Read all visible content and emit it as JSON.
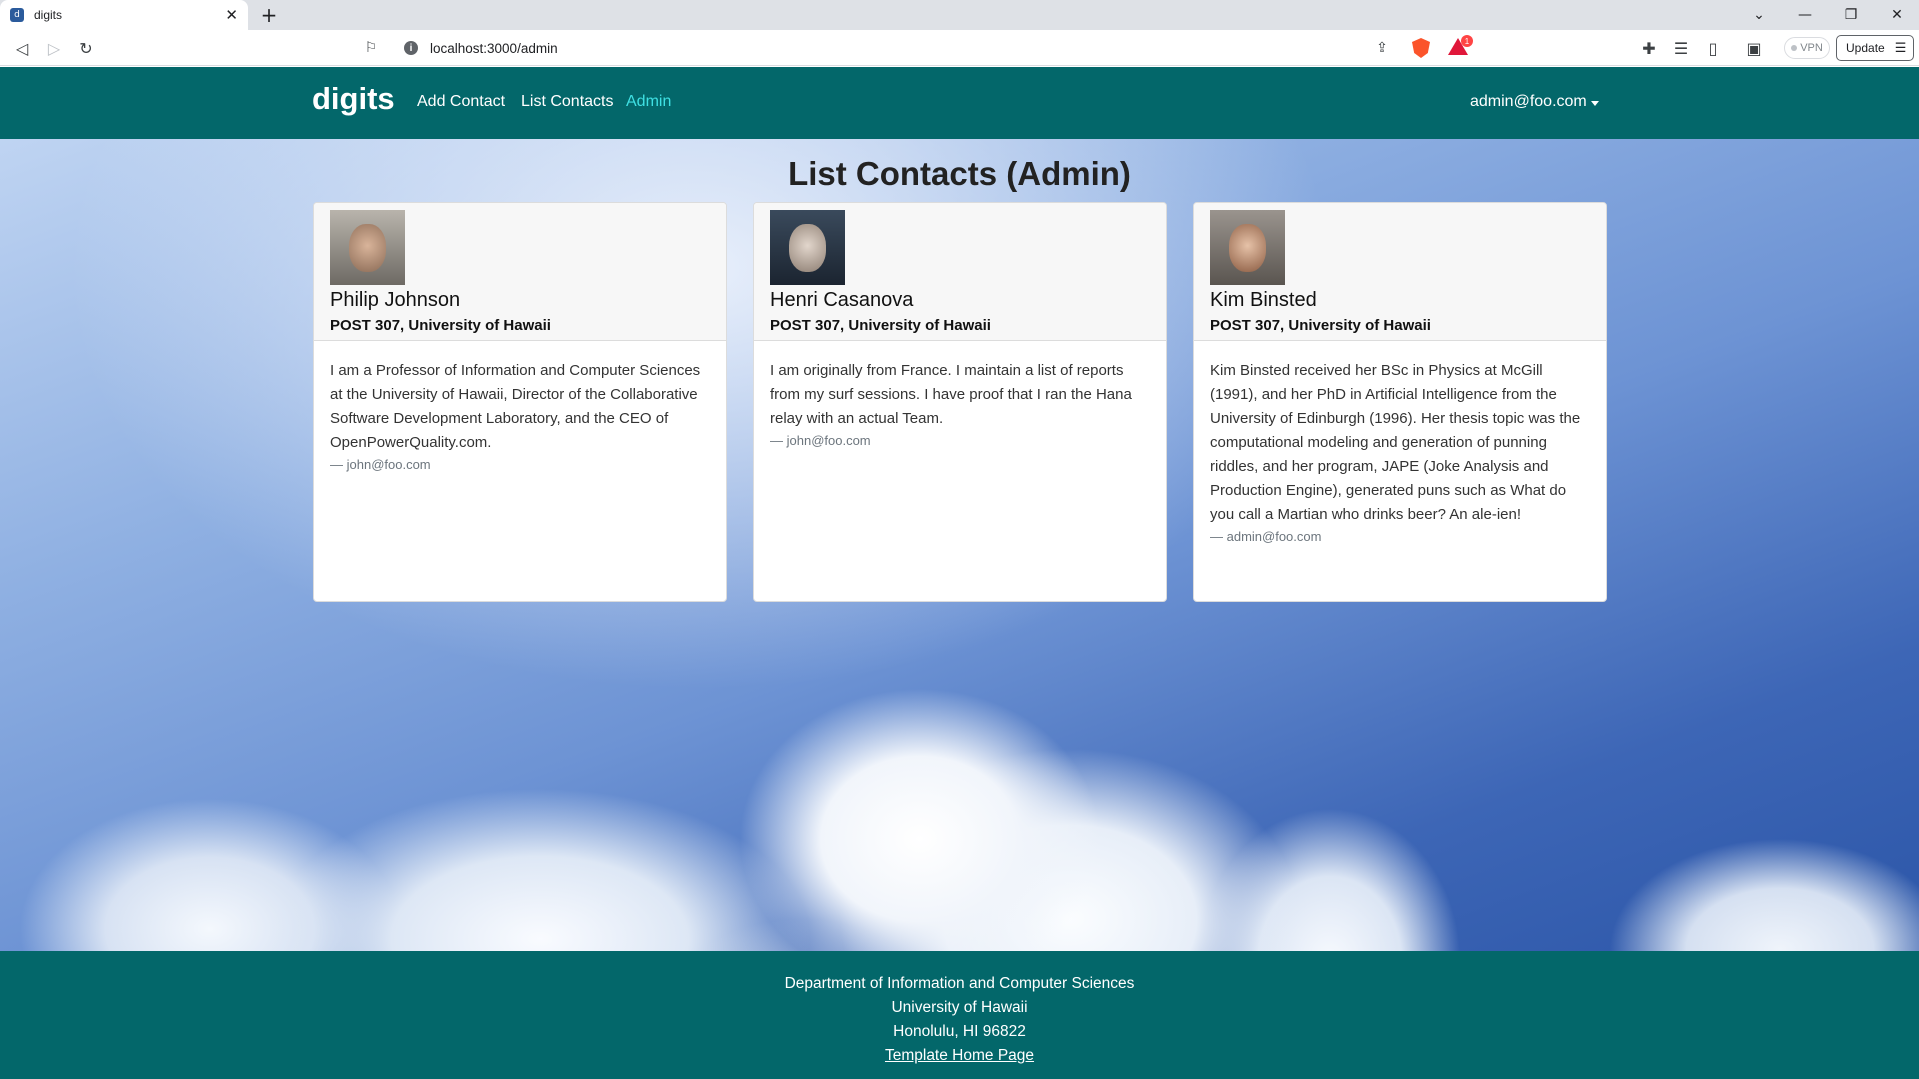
{
  "browser": {
    "tab_title": "digits",
    "favicon_glyph": "d",
    "new_tab": "+",
    "url": "localhost:3000/admin",
    "rewards_badge": "1",
    "vpn_label": "VPN",
    "update_label": "Update"
  },
  "navbar": {
    "brand": "digits",
    "links": [
      "Add Contact",
      "List Contacts",
      "Admin"
    ],
    "active_link": "Admin",
    "user": "admin@foo.com"
  },
  "page": {
    "title": "List Contacts (Admin)"
  },
  "contacts": [
    {
      "name": "Philip Johnson",
      "address": "POST 307, University of Hawaii",
      "description": "I am a Professor of Information and Computer Sciences at the University of Hawaii, Director of the Collaborative Software Development Laboratory, and the CEO of OpenPowerQuality.com.",
      "owner": "— john@foo.com"
    },
    {
      "name": "Henri Casanova",
      "address": "POST 307, University of Hawaii",
      "description": "I am originally from France. I maintain a list of reports from my surf sessions. I have proof that I ran the Hana relay with an actual Team.",
      "owner": "— john@foo.com"
    },
    {
      "name": "Kim Binsted",
      "address": "POST 307, University of Hawaii",
      "description": "Kim Binsted received her BSc in Physics at McGill (1991), and her PhD in Artificial Intelligence from the University of Edinburgh (1996). Her thesis topic was the computational modeling and generation of punning riddles, and her program, JAPE (Joke Analysis and Production Engine), generated puns such as What do you call a Martian who drinks beer? An ale-ien!",
      "owner": "— admin@foo.com"
    }
  ],
  "footer": {
    "lines": [
      "Department of Information and Computer Sciences",
      "University of Hawaii",
      "Honolulu, HI 96822"
    ],
    "link": "Template Home Page"
  },
  "colors": {
    "navbar": "#03676a",
    "active_link": "#3fe0e3",
    "sky_dark": "#2c56a8",
    "sky_light": "#bfd4f2"
  }
}
